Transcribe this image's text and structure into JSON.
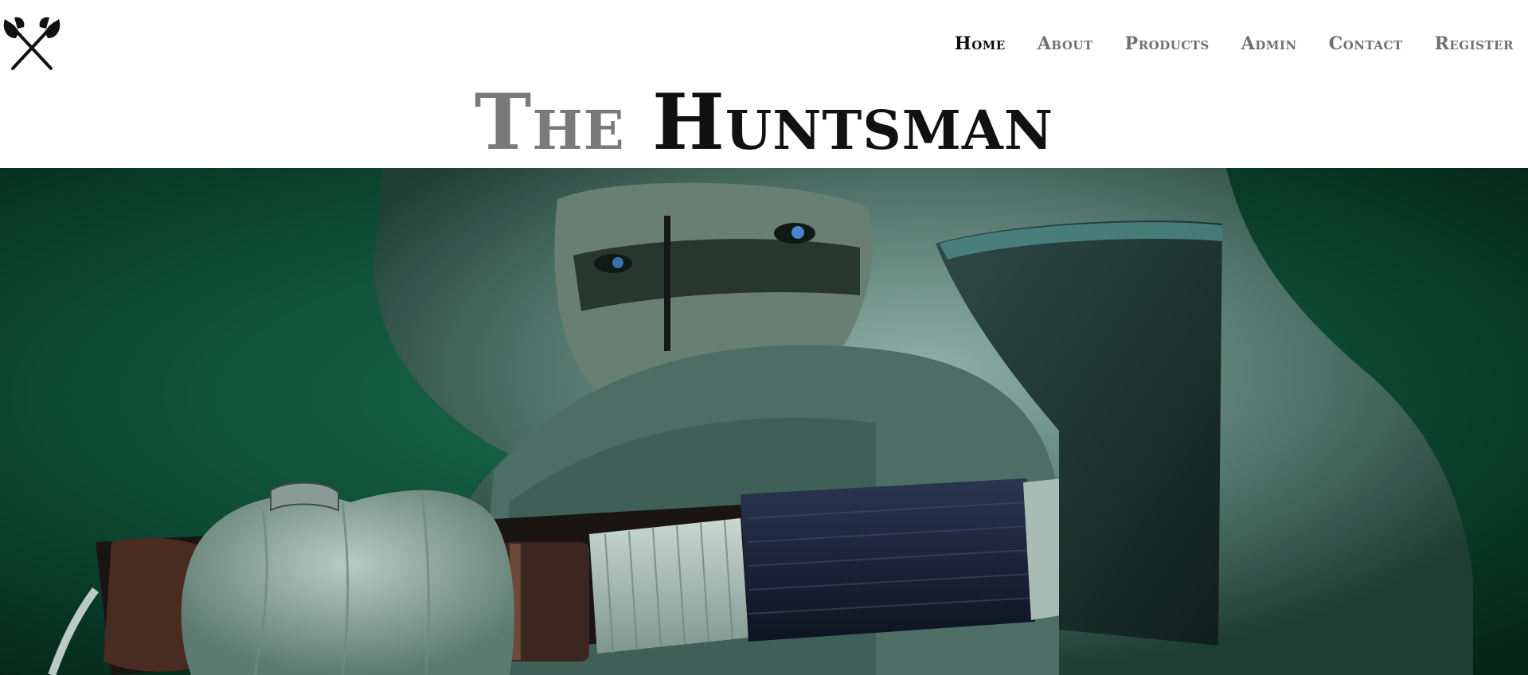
{
  "brand": {
    "logo_icon": "crossed-axes-icon"
  },
  "nav": {
    "items": [
      {
        "label": "Home",
        "active": true
      },
      {
        "label": "About",
        "active": false
      },
      {
        "label": "Products",
        "active": false
      },
      {
        "label": "Admin",
        "active": false
      },
      {
        "label": "Contact",
        "active": false
      },
      {
        "label": "Register",
        "active": false
      }
    ]
  },
  "site_title": {
    "part1": "The",
    "part2": "Huntsman"
  },
  "colors": {
    "nav_active": "#0d0d0d",
    "nav_inactive": "#707070",
    "title_light": "#7a7a7a",
    "title_dark": "#111111",
    "hero_green": "#0b3d2a"
  }
}
